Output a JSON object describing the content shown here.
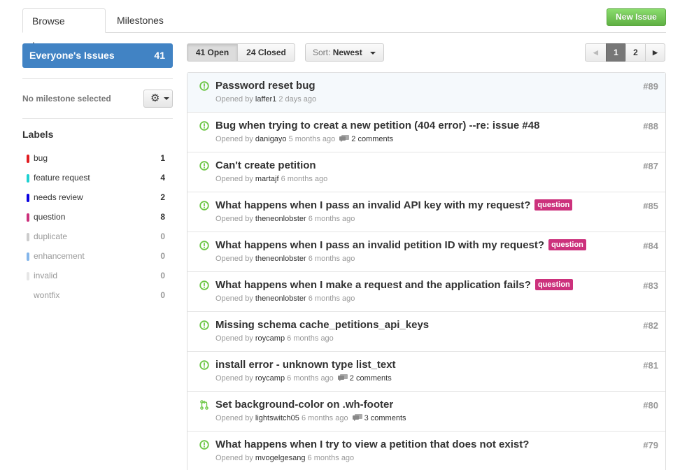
{
  "tabs": {
    "browse": "Browse Issues",
    "milestones": "Milestones"
  },
  "new_issue_label": "New Issue",
  "sidebar": {
    "filter": {
      "label": "Everyone's Issues",
      "count": "41"
    },
    "milestone": "No milestone selected",
    "labels_title": "Labels",
    "labels": [
      {
        "name": "bug",
        "count": "1",
        "color": "#e11d21",
        "active": true
      },
      {
        "name": "feature request",
        "count": "4",
        "color": "#1ed1d1",
        "active": true
      },
      {
        "name": "needs review",
        "count": "2",
        "color": "#0b02e1",
        "active": true
      },
      {
        "name": "question",
        "count": "8",
        "color": "#cc317c",
        "active": true
      },
      {
        "name": "duplicate",
        "count": "0",
        "color": "#cccccc",
        "active": false
      },
      {
        "name": "enhancement",
        "count": "0",
        "color": "#84b6eb",
        "active": false
      },
      {
        "name": "invalid",
        "count": "0",
        "color": "#e6e6e6",
        "active": false
      },
      {
        "name": "wontfix",
        "count": "0",
        "color": "#ffffff",
        "active": false
      }
    ]
  },
  "toolbar": {
    "open_label": "41 Open",
    "closed_label": "24 Closed",
    "sort_prefix": "Sort:",
    "sort_value": "Newest",
    "pages": [
      "1",
      "2"
    ],
    "prev_glyph": "◀",
    "next_glyph": "▶"
  },
  "issues": [
    {
      "title": "Password reset bug",
      "number": "#89",
      "opened": "Opened by",
      "user": "laffer1",
      "time": "2 days ago",
      "comments": "",
      "badge": "",
      "type": "issue"
    },
    {
      "title": "Bug when trying to creat a new petition (404 error) --re: issue #48",
      "number": "#88",
      "opened": "Opened by",
      "user": "danigayo",
      "time": "5 months ago",
      "comments": "2 comments",
      "badge": "",
      "type": "issue"
    },
    {
      "title": "Can't create petition",
      "number": "#87",
      "opened": "Opened by",
      "user": "martajf",
      "time": "6 months ago",
      "comments": "",
      "badge": "",
      "type": "issue"
    },
    {
      "title": "What happens when I pass an invalid API key with my request?",
      "number": "#85",
      "opened": "Opened by",
      "user": "theneonlobster",
      "time": "6 months ago",
      "comments": "",
      "badge": "question",
      "type": "issue"
    },
    {
      "title": "What happens when I pass an invalid petition ID with my request?",
      "number": "#84",
      "opened": "Opened by",
      "user": "theneonlobster",
      "time": "6 months ago",
      "comments": "",
      "badge": "question",
      "type": "issue"
    },
    {
      "title": "What happens when I make a request and the application fails?",
      "number": "#83",
      "opened": "Opened by",
      "user": "theneonlobster",
      "time": "6 months ago",
      "comments": "",
      "badge": "question",
      "type": "issue"
    },
    {
      "title": "Missing schema cache_petitions_api_keys",
      "number": "#82",
      "opened": "Opened by",
      "user": "roycamp",
      "time": "6 months ago",
      "comments": "",
      "badge": "",
      "type": "issue"
    },
    {
      "title": "install error - unknown type list_text",
      "number": "#81",
      "opened": "Opened by",
      "user": "roycamp",
      "time": "6 months ago",
      "comments": "2 comments",
      "badge": "",
      "type": "issue"
    },
    {
      "title": "Set background-color on .wh-footer",
      "number": "#80",
      "opened": "Opened by",
      "user": "lightswitch05",
      "time": "6 months ago",
      "comments": "3 comments",
      "badge": "",
      "type": "pull"
    },
    {
      "title": "What happens when I try to view a petition that does not exist?",
      "number": "#79",
      "opened": "Opened by",
      "user": "mvogelgesang",
      "time": "6 months ago",
      "comments": "",
      "badge": "",
      "type": "issue"
    }
  ],
  "colors": {
    "accent": "#4183c4",
    "open_green": "#6cc644",
    "badge": "#cc317c"
  }
}
